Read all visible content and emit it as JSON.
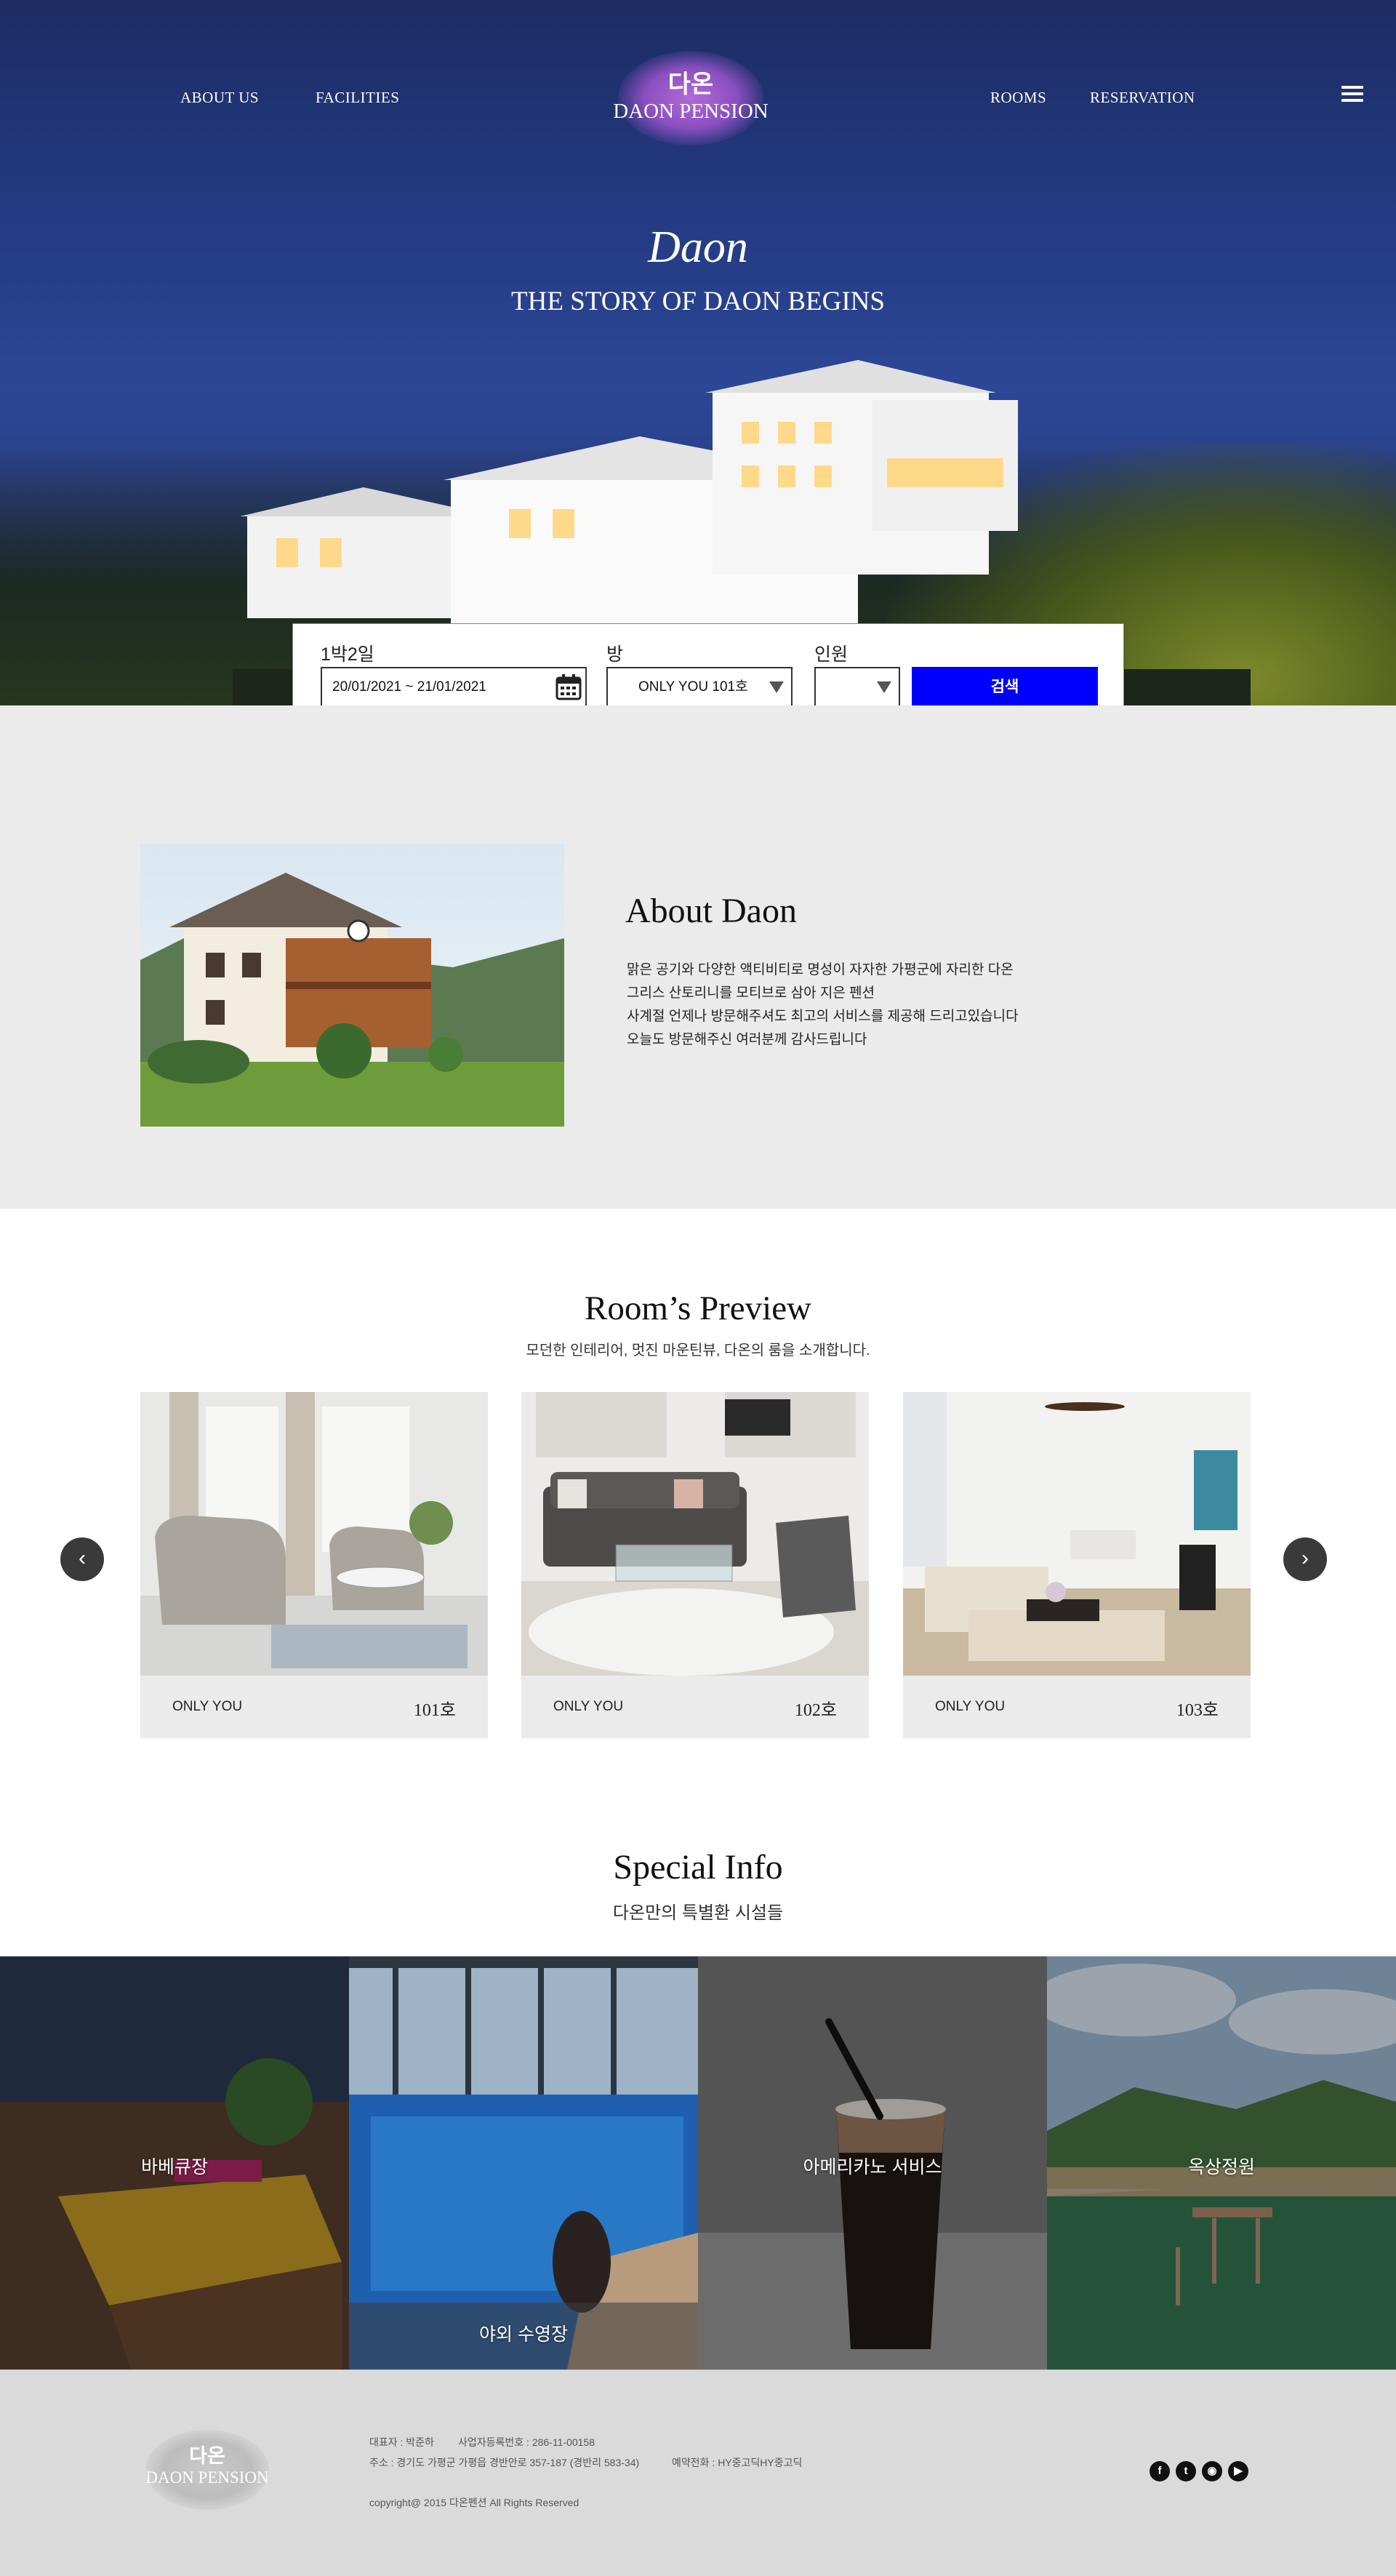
{
  "nav": {
    "about": "ABOUT US",
    "facilities": "FACILITIES",
    "rooms": "ROOMS",
    "reservation": "RESERVATION",
    "menu_icon": "hamburger-menu-icon"
  },
  "logo": {
    "ko": "다온",
    "en": "DAON PENSION"
  },
  "hero": {
    "script": "Daon",
    "title": "THE STORY OF DAON BEGINS"
  },
  "booking": {
    "stay_label": "1박2일",
    "dates": "20/01/2021 ~ 21/01/2021",
    "calendar_icon": "calendar-icon",
    "room_label": "방",
    "room_value": "ONLY YOU 101호",
    "guests_label": "인원",
    "guests_value": "",
    "search_label": "검색",
    "search_color": "#0000ff"
  },
  "about": {
    "title": "About Daon",
    "lines": [
      "맑은 공기와 다양한 액티비티로 명성이 자자한 가평군에 자리한 다온",
      "그리스 산토리니를 모티브로 삼아 지은 펜션",
      "사계절 언제나 방문해주셔도 최고의 서비스를 제공해 드리고있습니다",
      "오늘도 방문해주신 여러분께 감사드립니다"
    ]
  },
  "rooms": {
    "title": "Room’s Preview",
    "subtitle": "모던한 인테리어, 멋진 마운틴뷰, 다온의 룸을 소개합니다.",
    "prev_icon": "chevron-left-icon",
    "next_icon": "chevron-right-icon",
    "items": [
      {
        "name": "ONLY YOU",
        "number": "101호"
      },
      {
        "name": "ONLY YOU",
        "number": "102호"
      },
      {
        "name": "ONLY YOU",
        "number": "103호"
      }
    ]
  },
  "special": {
    "title": "Special Info",
    "subtitle": "다온만의 특별환 시설들",
    "tiles": [
      {
        "label": "바베큐장"
      },
      {
        "label": "야외 수영장"
      },
      {
        "label": "아메리카노 서비스"
      },
      {
        "label": "옥상정원"
      }
    ]
  },
  "footer": {
    "logo_ko": "다온",
    "logo_en": "DAON PENSION",
    "ceo": "대표자 : 박준하",
    "business_no": "사업자등록번호 : 286-11-00158",
    "address": "주소 : 경기도 가평군 가평읍 경반안로 357-187 (경반리 583-34)",
    "phone": "예약전화 : HY중고딕HY중고딕",
    "copyright": "copyright@ 2015 다온펜션 All Rights Reserved",
    "social": [
      "facebook-icon",
      "twitter-icon",
      "instagram-icon",
      "youtube-icon"
    ]
  }
}
